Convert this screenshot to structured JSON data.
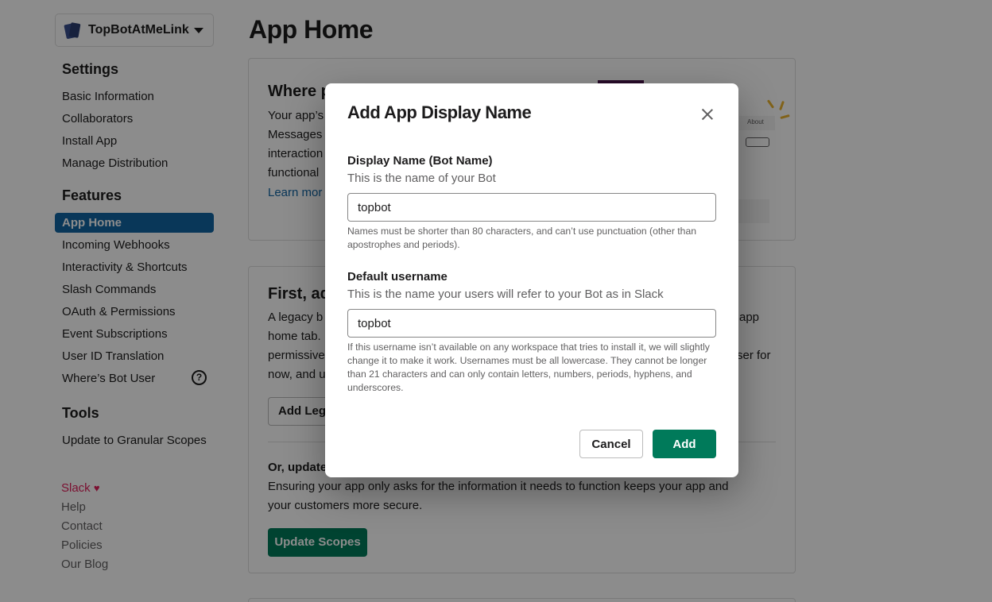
{
  "app_switcher": {
    "name": "TopBotAtMeLink"
  },
  "sidebar": {
    "settings_heading": "Settings",
    "settings_items": [
      "Basic Information",
      "Collaborators",
      "Install App",
      "Manage Distribution"
    ],
    "features_heading": "Features",
    "features_active": "App Home",
    "features_items": [
      "Incoming Webhooks",
      "Interactivity & Shortcuts",
      "Slash Commands",
      "OAuth & Permissions",
      "Event Subscriptions",
      "User ID Translation",
      "Where’s Bot User"
    ],
    "help_glyph": "?",
    "tools_heading": "Tools",
    "tools_items": [
      "Update to Granular Scopes"
    ],
    "footer": {
      "slack": "Slack",
      "heart": "♥",
      "links": [
        "Help",
        "Contact",
        "Policies",
        "Our Blog"
      ]
    }
  },
  "main": {
    "page_title": "App Home",
    "card1": {
      "heading": "Where p",
      "lines": [
        "Your app’s",
        "Messages",
        "interaction",
        "functional"
      ],
      "learn_more": "Learn mor",
      "preview_about": "About"
    },
    "card2": {
      "heading": "First, ad",
      "lines_left": [
        "A legacy b",
        "home tab.",
        "permissive",
        "now, and u"
      ],
      "lines_right": [
        "app",
        "",
        "ser for",
        ""
      ],
      "add_legacy_button": "Add Lega",
      "update_heading": "Or, update",
      "update_text_1": "Ensuring your app only asks for the information it needs to function keeps your app and",
      "update_text_2": "your customers more secure.",
      "update_scopes_button": "Update Scopes"
    }
  },
  "modal": {
    "title": "Add App Display Name",
    "display_name": {
      "label": "Display Name (Bot Name)",
      "sub": "This is the name of your Bot",
      "value": "topbot",
      "hint": "Names must be shorter than 80 characters, and can’t use punctuation (other than apostrophes and periods)."
    },
    "username": {
      "label": "Default username",
      "sub": "This is the name your users will refer to your Bot as in Slack",
      "value": "topbot",
      "hint": "If this username isn’t available on any workspace that tries to install it, we will slightly change it to make it work. Usernames must be all lowercase. They cannot be longer than 21 characters and can only contain letters, numbers, periods, hyphens, and underscores."
    },
    "cancel_label": "Cancel",
    "add_label": "Add"
  },
  "colors": {
    "accent_blue": "#1264a3",
    "primary_green": "#007a5a",
    "slack_red": "#e01e5a",
    "overlay": "rgba(0,0,0,0.45)"
  }
}
